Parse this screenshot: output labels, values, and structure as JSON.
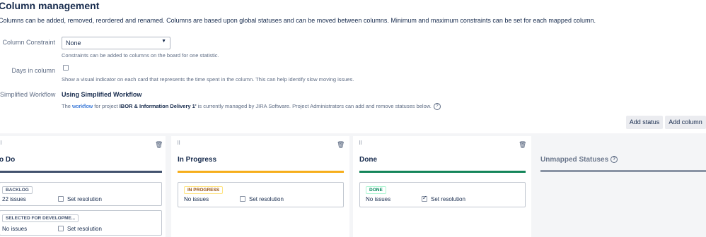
{
  "page": {
    "title": "Column management",
    "description": "Columns can be added, removed, reordered and renamed. Columns are based upon global statuses and can be moved between columns. Minimum and maximum constraints can be set for each mapped column."
  },
  "settings": {
    "constraint": {
      "label": "Column Constraint",
      "value": "None",
      "help": "Constraints can be added to columns on the board for one statistic."
    },
    "days_in_column": {
      "label": "Days in column",
      "checked": false,
      "help": "Show a visual indicator on each card that represents the time spent in the column. This can help identify slow moving issues."
    },
    "workflow": {
      "label": "Simplified Workflow",
      "value": "Using Simplified Workflow",
      "text_prefix": "The ",
      "link": "workflow",
      "text_mid": " for project ",
      "project": "IBOR & Information Delivery 1'",
      "text_suffix": " is currently managed by JIRA Software. Project Administrators can add and remove statuses below."
    }
  },
  "toolbar": {
    "add_status": "Add status",
    "add_column": "Add column"
  },
  "columns": [
    {
      "title": "o Do",
      "color": "#42526e",
      "statuses": [
        {
          "name": "BACKLOG",
          "issues": "22 issues",
          "resolution": "Set resolution",
          "checked": false,
          "lozenge_color": "#42526e",
          "lozenge_border": "#c1c7d0"
        },
        {
          "name": "SELECTED FOR DEVELOPME...",
          "issues": "No issues",
          "resolution": "Set resolution",
          "checked": false,
          "lozenge_color": "#42526e",
          "lozenge_border": "#c1c7d0"
        }
      ]
    },
    {
      "title": "In Progress",
      "color": "#f6ae1c",
      "statuses": [
        {
          "name": "IN PROGRESS",
          "issues": "No issues",
          "resolution": "Set resolution",
          "checked": false,
          "lozenge_color": "#974f0c",
          "lozenge_border": "#ffe380"
        }
      ]
    },
    {
      "title": "Done",
      "color": "#14855a",
      "statuses": [
        {
          "name": "DONE",
          "issues": "No issues",
          "resolution": "Set resolution",
          "checked": true,
          "lozenge_color": "#00875a",
          "lozenge_border": "#abf5d1"
        }
      ]
    }
  ],
  "unmapped": {
    "title": "Unmapped Statuses",
    "help_icon": "question-circle-icon"
  },
  "icons": {
    "drag": "drag-handle-icon",
    "trash": "trash-icon",
    "help": "question-circle-icon",
    "dropdown": "dropdown-caret-icon"
  }
}
